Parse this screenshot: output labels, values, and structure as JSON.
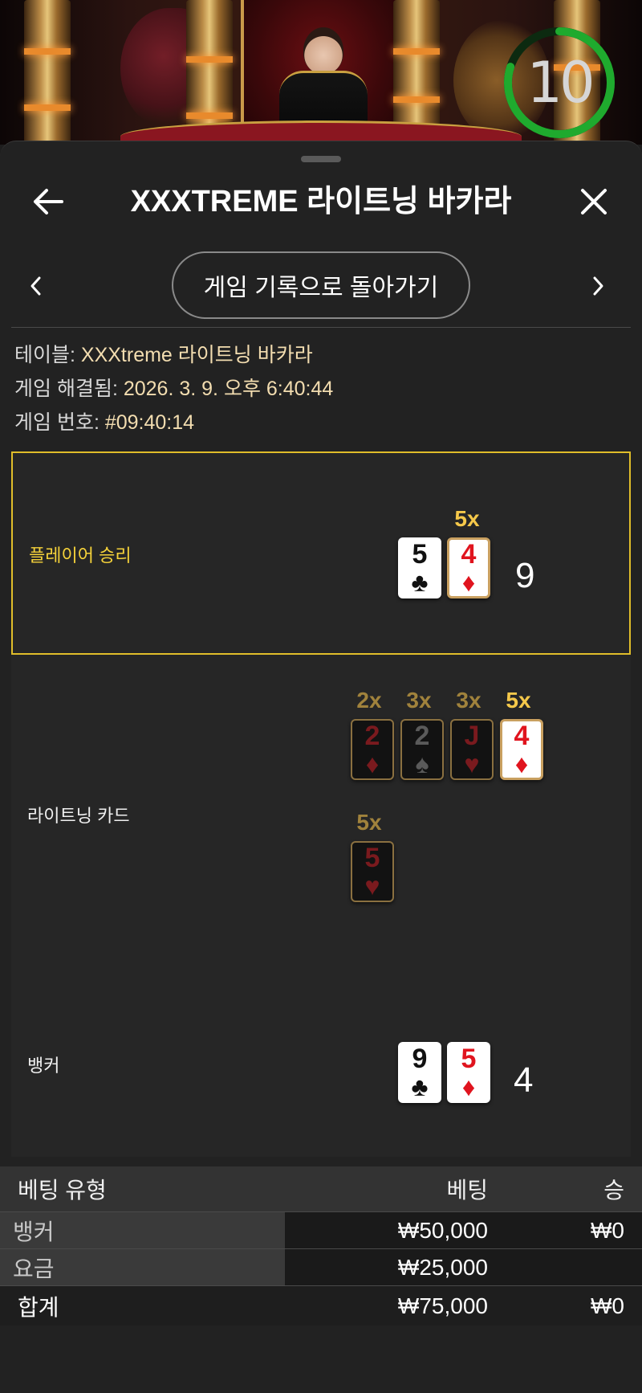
{
  "timer": {
    "value": "10",
    "color": "#1faa2e",
    "progress": 0.8
  },
  "header": {
    "title": "XXXTREME 라이트닝 바카라",
    "back_icon": "arrow-left-icon",
    "close_icon": "close-icon"
  },
  "nav": {
    "button_label": "게임 기록으로 돌아가기",
    "prev_icon": "chevron-left-icon",
    "next_icon": "chevron-right-icon"
  },
  "info": {
    "table_label": "테이블: ",
    "table_value": "XXXtreme 라이트닝 바카라",
    "resolved_label": "게임 해결됨: ",
    "resolved_value": "2026. 3. 9. 오후 6:40:44",
    "game_no_label": "게임 번호: ",
    "game_no_value": "#09:40:14"
  },
  "player": {
    "label": "플레이어 승리",
    "total": "9",
    "cards": [
      {
        "rank": "5",
        "suit": "♣",
        "color": "black",
        "multiplier": ""
      },
      {
        "rank": "4",
        "suit": "♦",
        "color": "red",
        "multiplier": "5x"
      }
    ]
  },
  "lightning": {
    "label": "라이트닝 카드",
    "cards": [
      {
        "rank": "2",
        "suit": "♦",
        "color": "red",
        "multiplier": "2x",
        "lit": false
      },
      {
        "rank": "2",
        "suit": "♠",
        "color": "gray",
        "multiplier": "3x",
        "lit": false
      },
      {
        "rank": "J",
        "suit": "♥",
        "color": "red",
        "multiplier": "3x",
        "lit": false
      },
      {
        "rank": "4",
        "suit": "♦",
        "color": "red",
        "multiplier": "5x",
        "lit": true
      },
      {
        "rank": "5",
        "suit": "♥",
        "color": "red",
        "multiplier": "5x",
        "lit": false
      }
    ]
  },
  "banker": {
    "label": "뱅커",
    "total": "4",
    "cards": [
      {
        "rank": "9",
        "suit": "♣",
        "color": "black"
      },
      {
        "rank": "5",
        "suit": "♦",
        "color": "red"
      }
    ]
  },
  "bets": {
    "headers": {
      "type": "베팅 유형",
      "bet": "베팅",
      "win": "승"
    },
    "rows": [
      {
        "type": "뱅커",
        "bet": "₩50,000",
        "win": "₩0"
      },
      {
        "type": "요금",
        "bet": "₩25,000",
        "win": ""
      }
    ],
    "total": {
      "type": "합계",
      "bet": "₩75,000",
      "win": "₩0"
    }
  },
  "colors": {
    "accent_gold": "#e0bd2a",
    "multiplier_gold": "#f5c84a",
    "card_red": "#e0141e"
  }
}
